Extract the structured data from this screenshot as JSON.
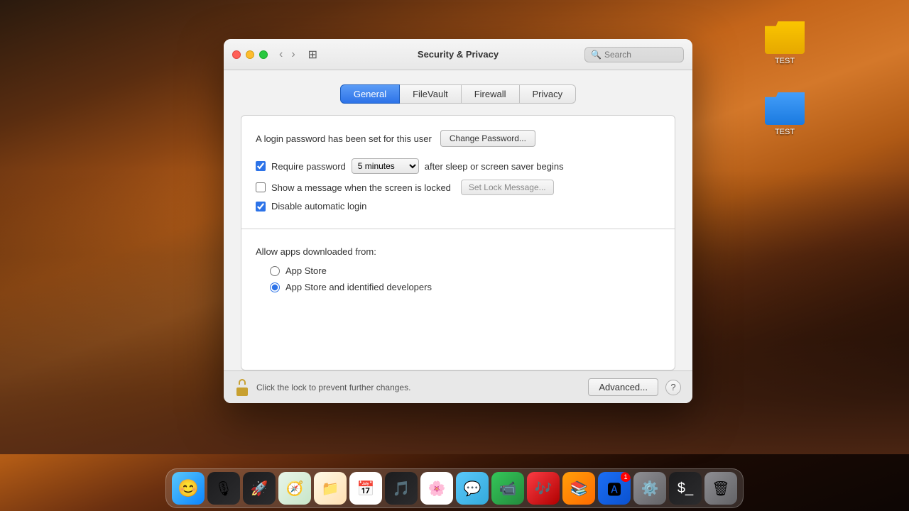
{
  "desktop": {
    "icons": [
      {
        "id": "yellow-folder",
        "label": "TEST",
        "color": "yellow"
      },
      {
        "id": "blue-folder",
        "label": "TEST",
        "color": "blue"
      }
    ]
  },
  "window": {
    "title": "Security & Privacy",
    "search_placeholder": "Search",
    "traffic_lights": {
      "close_label": "close",
      "minimize_label": "minimize",
      "maximize_label": "maximize"
    },
    "tabs": [
      {
        "id": "general",
        "label": "General",
        "active": true
      },
      {
        "id": "filevault",
        "label": "FileVault",
        "active": false
      },
      {
        "id": "firewall",
        "label": "Firewall",
        "active": false
      },
      {
        "id": "privacy",
        "label": "Privacy",
        "active": false
      }
    ],
    "general": {
      "login_password_text": "A login password has been set for this user",
      "change_password_btn": "Change Password...",
      "require_password_label": "Require password",
      "require_password_checked": true,
      "require_password_dropdown": "5 minutes",
      "require_password_suffix": "after sleep or screen saver begins",
      "show_message_label": "Show a message when the screen is locked",
      "show_message_checked": false,
      "set_lock_message_btn": "Set Lock Message...",
      "disable_autologin_label": "Disable automatic login",
      "disable_autologin_checked": true,
      "allow_apps_label": "Allow apps downloaded from:",
      "app_store_label": "App Store",
      "app_store_selected": false,
      "app_store_identified_label": "App Store and identified developers",
      "app_store_identified_selected": true
    },
    "bottom": {
      "lock_text": "Click the lock to prevent further changes.",
      "advanced_btn": "Advanced...",
      "help_btn": "?"
    }
  },
  "dock": {
    "items": [
      {
        "id": "finder",
        "label": "Finder",
        "emoji": "🔵"
      },
      {
        "id": "siri",
        "label": "Siri",
        "emoji": "🎙"
      },
      {
        "id": "launchpad",
        "label": "Launchpad",
        "emoji": "🚀"
      },
      {
        "id": "safari",
        "label": "Safari",
        "emoji": "🧭"
      },
      {
        "id": "files",
        "label": "Files",
        "emoji": "📁"
      },
      {
        "id": "calendar",
        "label": "Calendar",
        "emoji": "📅"
      },
      {
        "id": "music",
        "label": "Music",
        "emoji": "🎵"
      },
      {
        "id": "photos",
        "label": "Photos",
        "emoji": "🌸"
      },
      {
        "id": "messages",
        "label": "Messages",
        "emoji": "💬"
      },
      {
        "id": "facetime",
        "label": "FaceTime",
        "emoji": "📹"
      },
      {
        "id": "itunes",
        "label": "iTunes",
        "emoji": "🎶"
      },
      {
        "id": "books",
        "label": "Books",
        "emoji": "📚"
      },
      {
        "id": "appstore",
        "label": "App Store",
        "emoji": "🅰",
        "badge": "1"
      },
      {
        "id": "systemprefs",
        "label": "System Preferences",
        "emoji": "⚙"
      },
      {
        "id": "terminal",
        "label": "Terminal",
        "emoji": "⬛"
      },
      {
        "id": "trash",
        "label": "Trash",
        "emoji": "🗑"
      }
    ]
  }
}
